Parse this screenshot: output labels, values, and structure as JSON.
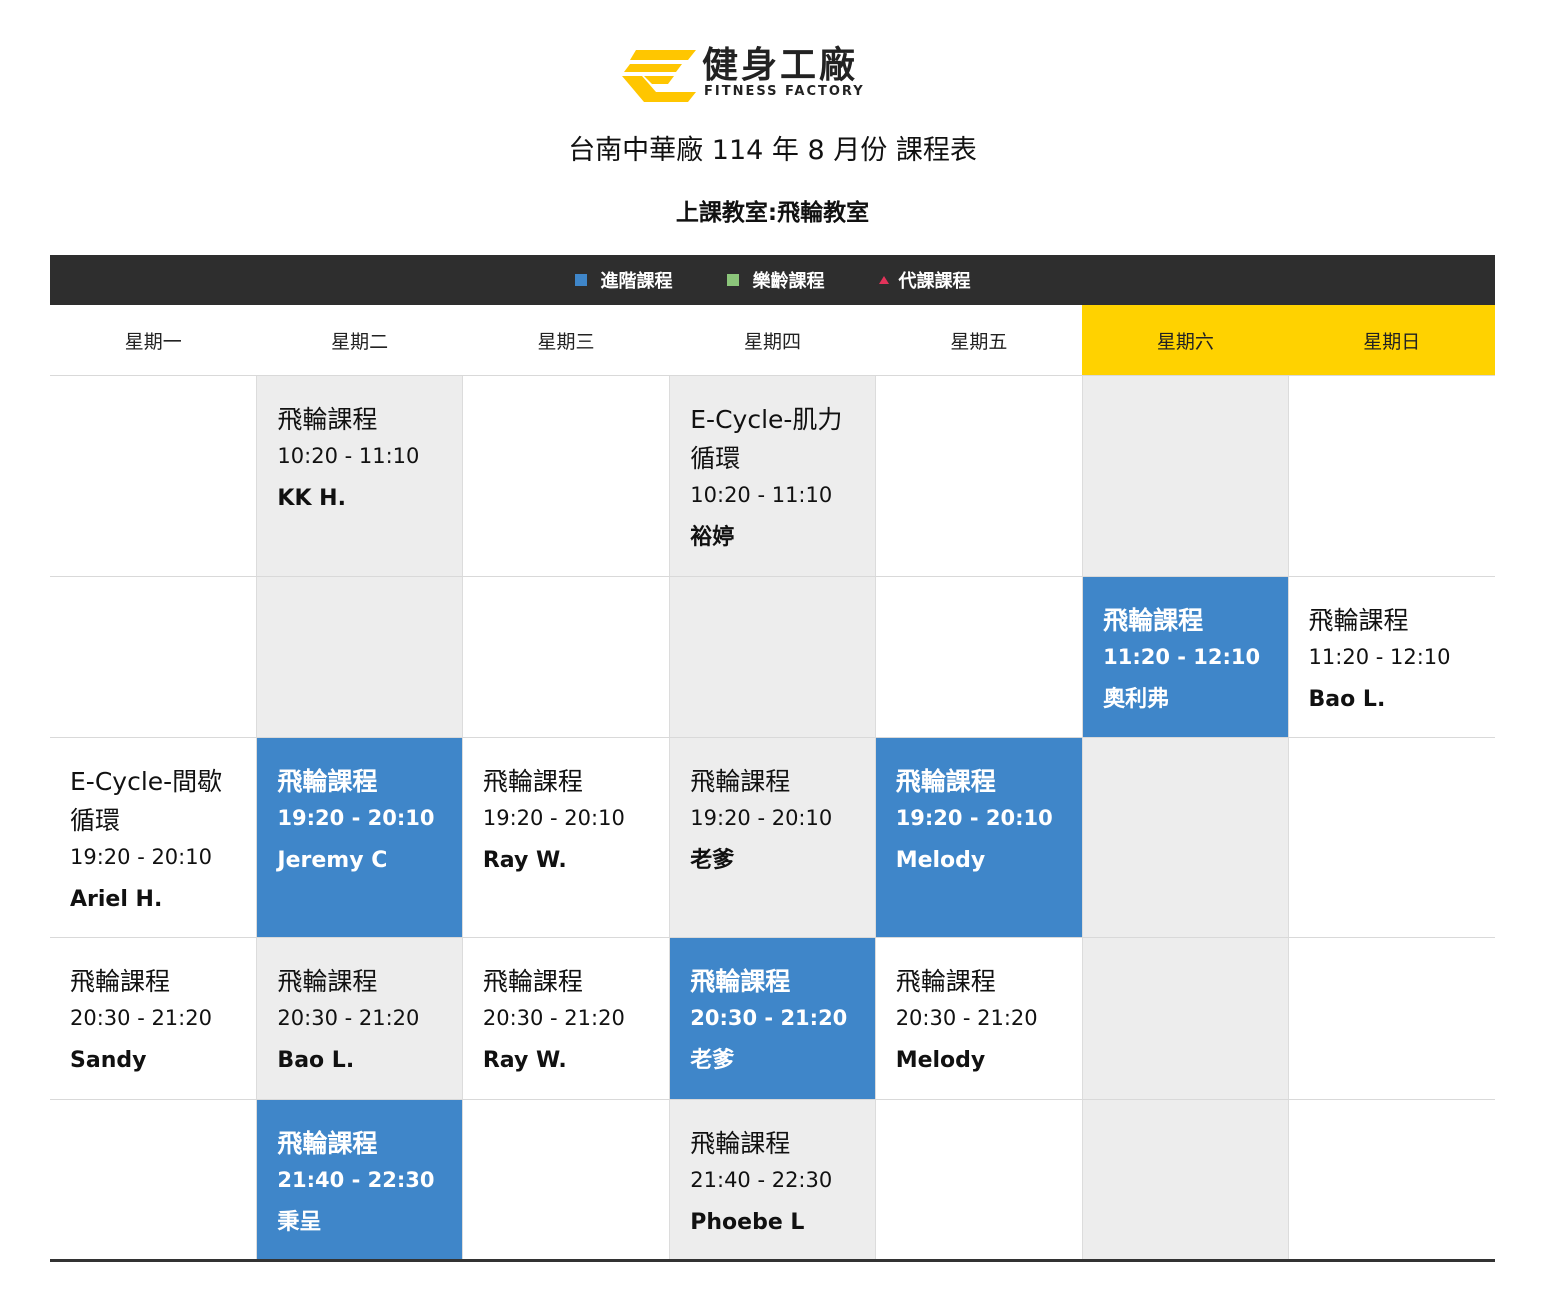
{
  "brand": {
    "name_cn": "健身工廠",
    "name_en": "FITNESS FACTORY",
    "color": "#ffc600"
  },
  "title": "台南中華廠 114 年 8 月份 課程表",
  "classroom": "上課教室:飛輪教室",
  "legend": [
    {
      "label": "進階課程",
      "color": "#3f86c9",
      "shape": "square"
    },
    {
      "label": "樂齡課程",
      "color": "#8bc57a",
      "shape": "square"
    },
    {
      "label": "代課課程",
      "color": "#e2335a",
      "shape": "triangle"
    }
  ],
  "weekend_color": "#ffd200",
  "days": [
    "星期一",
    "星期二",
    "星期三",
    "星期四",
    "星期五",
    "星期六",
    "星期日"
  ],
  "rows": [
    [
      null,
      {
        "name": "飛輪課程",
        "time": "10:20 - 11:10",
        "coach": "KK H.",
        "advanced": false
      },
      null,
      {
        "name": "E-Cycle-肌力循環",
        "time": "10:20 - 11:10",
        "coach": "裕婷",
        "advanced": false
      },
      null,
      null,
      null
    ],
    [
      null,
      null,
      null,
      null,
      null,
      {
        "name": "飛輪課程",
        "time": "11:20 - 12:10",
        "coach": "奧利弗",
        "advanced": true
      },
      {
        "name": "飛輪課程",
        "time": "11:20 - 12:10",
        "coach": "Bao L.",
        "advanced": false
      }
    ],
    [
      {
        "name": "E-Cycle-間歇循環",
        "time": "19:20 - 20:10",
        "coach": "Ariel H.",
        "advanced": false
      },
      {
        "name": "飛輪課程",
        "time": "19:20 - 20:10",
        "coach": "Jeremy C",
        "advanced": true
      },
      {
        "name": "飛輪課程",
        "time": "19:20 - 20:10",
        "coach": "Ray W.",
        "advanced": false
      },
      {
        "name": "飛輪課程",
        "time": "19:20 - 20:10",
        "coach": "老爹",
        "advanced": false
      },
      {
        "name": "飛輪課程",
        "time": "19:20 - 20:10",
        "coach": "Melody",
        "advanced": true
      },
      null,
      null
    ],
    [
      {
        "name": "飛輪課程",
        "time": "20:30 - 21:20",
        "coach": "Sandy",
        "advanced": false
      },
      {
        "name": "飛輪課程",
        "time": "20:30 - 21:20",
        "coach": "Bao L.",
        "advanced": false
      },
      {
        "name": "飛輪課程",
        "time": "20:30 - 21:20",
        "coach": "Ray W.",
        "advanced": false
      },
      {
        "name": "飛輪課程",
        "time": "20:30 - 21:20",
        "coach": "老爹",
        "advanced": true
      },
      {
        "name": "飛輪課程",
        "time": "20:30 - 21:20",
        "coach": "Melody",
        "advanced": false
      },
      null,
      null
    ],
    [
      null,
      {
        "name": "飛輪課程",
        "time": "21:40 - 22:30",
        "coach": "秉呈",
        "advanced": true
      },
      null,
      {
        "name": "飛輪課程",
        "time": "21:40 - 22:30",
        "coach": "Phoebe L",
        "advanced": false
      },
      null,
      null,
      null
    ]
  ]
}
